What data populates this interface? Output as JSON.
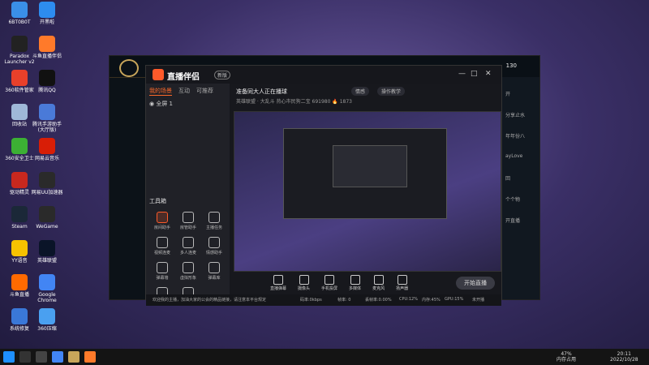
{
  "desktop": {
    "icons": [
      {
        "label": "6BT0B0T",
        "color": "#3a8fe8"
      },
      {
        "label": "开黑啦",
        "color": "#2d8cf0"
      },
      {
        "label": "Paradox Launcher v2",
        "color": "#222222"
      },
      {
        "label": "斗鱼直播伴侣",
        "color": "#ff7a2a"
      },
      {
        "label": "360软件管家",
        "color": "#e8402a"
      },
      {
        "label": "腾讯QQ",
        "color": "#111111"
      },
      {
        "label": "回收站",
        "color": "#9fb8d8"
      },
      {
        "label": "腾讯手游助手 (大厅版)",
        "color": "#4a7ad8"
      },
      {
        "label": "360安全卫士",
        "color": "#3cb034"
      },
      {
        "label": "网易云音乐",
        "color": "#d81e06"
      },
      {
        "label": "驱动精灵",
        "color": "#c8281e"
      },
      {
        "label": "网易UU加速器",
        "color": "#2a2a2a"
      },
      {
        "label": "Steam",
        "color": "#1b2838"
      },
      {
        "label": "WeGame",
        "color": "#2a2a2a"
      },
      {
        "label": "YY语音",
        "color": "#f6c200"
      },
      {
        "label": "英雄联盟",
        "color": "#0a1428"
      },
      {
        "label": "斗鱼直播",
        "color": "#ff6a00"
      },
      {
        "label": "Google Chrome",
        "color": "#4285f4"
      },
      {
        "label": "系统修复",
        "color": "#3a78d8"
      },
      {
        "label": "360压缩",
        "color": "#4aa0f0"
      }
    ]
  },
  "lol": {
    "right_text": "130",
    "side_rows": [
      "开",
      "分享止水",
      "年年份八",
      "ayLove",
      "回",
      "个个物",
      "开直播"
    ]
  },
  "app": {
    "name": "直播伴侣",
    "version": "新版",
    "tabs": [
      "我的场景",
      "互动",
      "可推荐"
    ],
    "scene_label": "◉  全屏 1",
    "tool_title": "工具箱",
    "tools": [
      "房间助手",
      "房管助手",
      "主播任务",
      "视频连麦",
      "多人连麦",
      "情感助手",
      "弹幕墙",
      "虚拟形象",
      "弹幕库",
      "截屏",
      "录像"
    ],
    "room_title": "准备同大人正在播球",
    "tags": [
      "情感",
      "操作教学"
    ],
    "room_info": "英雄联盟 · 大乱斗   热心市民狗二宝   691980   🔥 1873",
    "bottom": [
      "直播弹幕",
      "摄像头",
      "手机投屏",
      "多媒体",
      "麦克风",
      "扬声器"
    ],
    "start_label": "开始直播",
    "status": [
      "欢迎我的主播，加油大家的公会的精品链接，请注意本平台规定",
      "码率:0kbps",
      "帧率: 0",
      "丢帧率:0.00%",
      "CPU:12%",
      "内存:45%",
      "GPU:15%",
      "未开播"
    ]
  },
  "taskbar": {
    "battery": "47%",
    "battery_label": "内存占用",
    "time": "20:11",
    "date": "2022/10/28"
  }
}
